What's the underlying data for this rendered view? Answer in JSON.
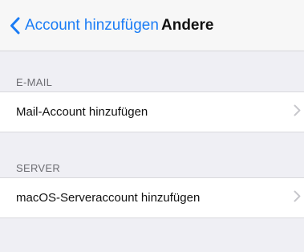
{
  "navbar": {
    "back_label": "Account hinzufügen",
    "title": "Andere"
  },
  "sections": [
    {
      "header": "E-MAIL",
      "items": [
        {
          "label": "Mail-Account hinzufügen"
        }
      ]
    },
    {
      "header": "SERVER",
      "items": [
        {
          "label": "macOS-Serveraccount hinzufügen"
        }
      ]
    }
  ],
  "colors": {
    "accent": "#1a7cf5",
    "background": "#efeff4",
    "cell_background": "#ffffff",
    "section_header_text": "#6d6d72",
    "chevron": "#c7c7cc"
  },
  "icons": {
    "back": "chevron-left-icon",
    "disclosure": "chevron-right-icon"
  }
}
